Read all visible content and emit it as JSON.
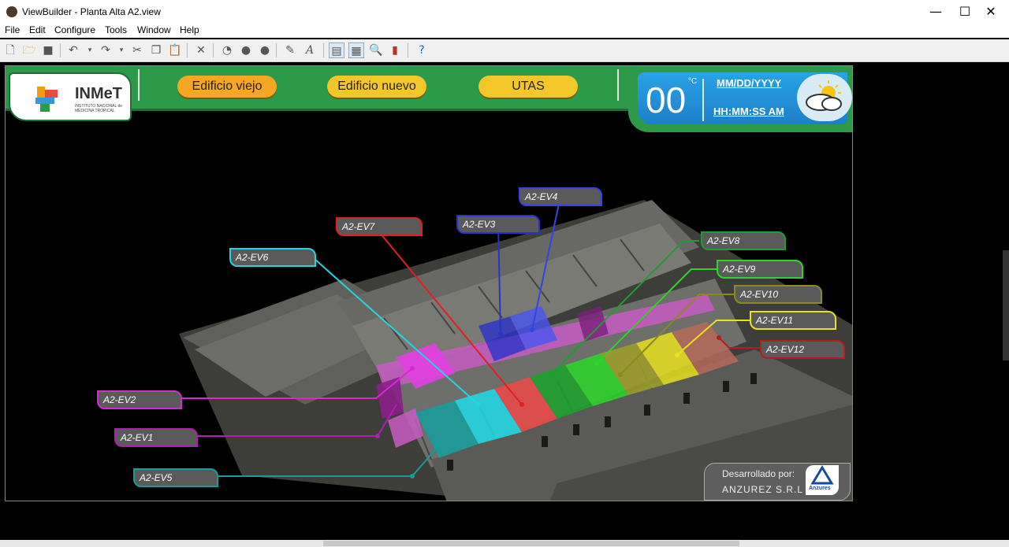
{
  "window": {
    "title": "ViewBuilder - Planta Alta A2.view",
    "minimize": "—",
    "maximize": "☐",
    "close": "✕"
  },
  "menu": [
    "File",
    "Edit",
    "Configure",
    "Tools",
    "Window",
    "Help"
  ],
  "toolbar": {
    "icons": [
      "new-icon",
      "open-icon",
      "save-icon",
      "undo-icon",
      "redo-icon",
      "cut-icon",
      "copy-icon",
      "paste-icon",
      "pointer-icon",
      "help-a-icon",
      "help-b-icon",
      "help-c-icon",
      "link-icon",
      "text-icon",
      "view-a-icon",
      "view-b-icon",
      "zoom-icon",
      "chart-icon",
      "help-icon"
    ]
  },
  "header": {
    "logo_text": "INMeT",
    "logo_sub": "INSTITUTO NACIONAL de MEDICINA TROPICAL",
    "buttons": [
      "Edificio viejo",
      "Edificio nuevo",
      "UTAS"
    ],
    "button_colors": [
      "#f5a623",
      "#f3c62a",
      "#f3c62a"
    ]
  },
  "weather": {
    "temperature": "00",
    "unit": "°C",
    "date": "MM/DD/YYYY",
    "time": "HH:MM:SS AM",
    "icon": "partly-cloudy-icon"
  },
  "tags": [
    {
      "label": "A2-EV1",
      "color": "#b01fb0"
    },
    {
      "label": "A2-EV2",
      "color": "#d22bd2"
    },
    {
      "label": "A2-EV3",
      "color": "#2a33c8"
    },
    {
      "label": "A2-EV4",
      "color": "#3344e6"
    },
    {
      "label": "A2-EV5",
      "color": "#1a9b9b"
    },
    {
      "label": "A2-EV6",
      "color": "#22d5e0"
    },
    {
      "label": "A2-EV7",
      "color": "#e02020"
    },
    {
      "label": "A2-EV8",
      "color": "#1e9e2e"
    },
    {
      "label": "A2-EV9",
      "color": "#2ed32e"
    },
    {
      "label": "A2-EV10",
      "color": "#8a8a1e"
    },
    {
      "label": "A2-EV11",
      "color": "#e8e020"
    },
    {
      "label": "A2-EV12",
      "color": "#b31e1e"
    }
  ],
  "credits": {
    "line1": "Desarrollado por:",
    "line2": "ANZUREZ S.R.L",
    "logo_text": "Anzures"
  }
}
